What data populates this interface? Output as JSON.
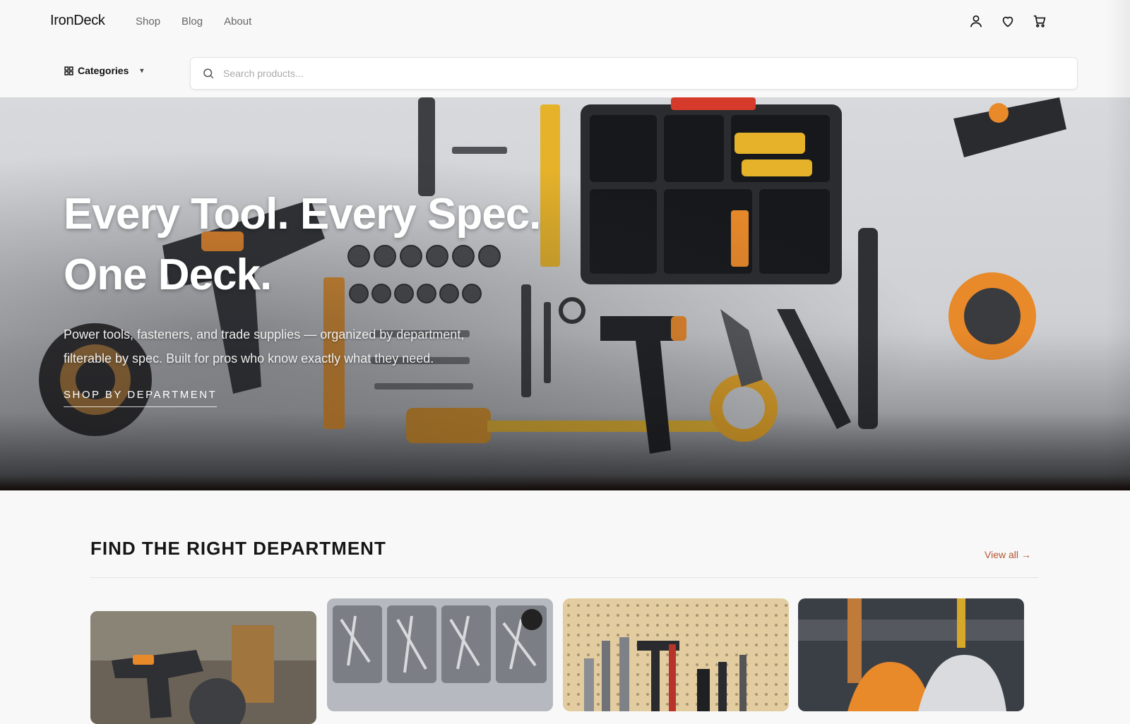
{
  "header": {
    "logo": "IronDeck",
    "nav": [
      "Shop",
      "Blog",
      "About"
    ],
    "icons": [
      "user-icon",
      "heart-icon",
      "cart-icon"
    ]
  },
  "subbar": {
    "categories_label": "Categories",
    "search_placeholder": "Search products..."
  },
  "hero": {
    "title_line1": "Every Tool. Every Spec.",
    "title_line2": "One Deck.",
    "subtitle": "Power tools, fasteners, and trade supplies — organized by department, filterable by spec. Built for pros who know exactly what they need.",
    "cta": "SHOP BY DEPARTMENT"
  },
  "departments": {
    "heading": "FIND THE RIGHT DEPARTMENT",
    "view_all": "View all →",
    "cards": [
      {
        "name": "power-tools-card"
      },
      {
        "name": "fasteners-card"
      },
      {
        "name": "hand-tools-card"
      },
      {
        "name": "safety-gear-card"
      }
    ]
  },
  "colors": {
    "accent": "#b5562f",
    "background": "#f8f8f8",
    "hero_orange": "#e8892a"
  }
}
